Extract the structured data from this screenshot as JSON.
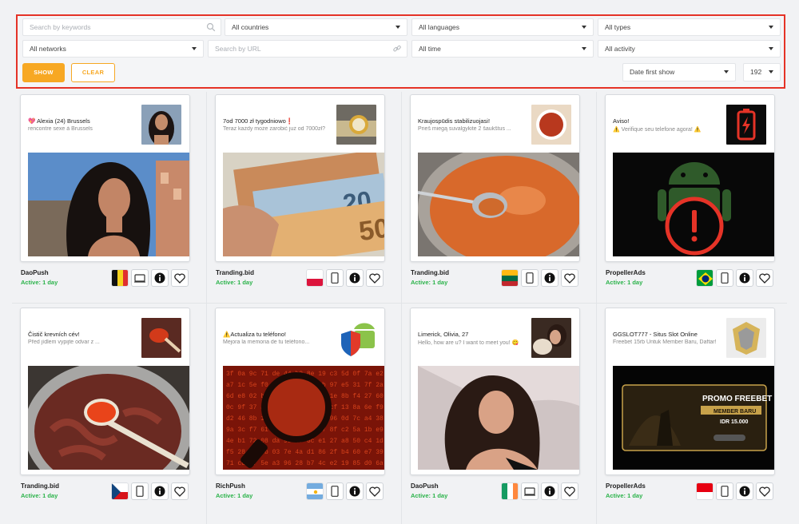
{
  "filters": {
    "keywords_placeholder": "Search by keywords",
    "countries": "All countries",
    "languages": "All languages",
    "types": "All types",
    "networks": "All networks",
    "url_placeholder": "Search by URL",
    "time": "All time",
    "activity": "All activity",
    "show_label": "SHOW",
    "clear_label": "CLEAR",
    "sort": "Date first show",
    "per_page": "192"
  },
  "ads": [
    {
      "title": "💖 Alexia (24) Brussels",
      "subtitle": "rencontre sexe à Brussels",
      "network": "DaoPush",
      "activity": "Active: 1 day",
      "flag": "belgium",
      "device": "desktop",
      "icon": "woman-portrait-icon",
      "image": "woman-selfie-image"
    },
    {
      "title": "7od 7000 zł tygodniowo❗",
      "subtitle": "Teraz każdy może zarobić już od 7000zł?",
      "network": "Tranding.bid",
      "activity": "Active: 1 day",
      "flag": "poland",
      "device": "mobile",
      "icon": "gold-watch-icon",
      "image": "euro-banknotes-image"
    },
    {
      "title": "Kraujospūdis stabilizuojasi!",
      "subtitle": "Prieš miegą suvalgykite 2 šaukštus ...",
      "network": "Tranding.bid",
      "activity": "Active: 1 day",
      "flag": "lithuania",
      "device": "mobile",
      "icon": "sauce-bowl-icon",
      "image": "orange-soup-image"
    },
    {
      "title": "Aviso!",
      "subtitle": "⚠️ Verifique seu telefone agora! ⚠️",
      "network": "PropellerAds",
      "activity": "Active: 1 day",
      "flag": "brazil",
      "device": "mobile",
      "icon": "low-battery-icon",
      "image": "android-warning-image"
    },
    {
      "title": "Čistič krevních cév!",
      "subtitle": "Před jídlem vypijte odvar z ...",
      "network": "Tranding.bid",
      "activity": "Active: 1 day",
      "flag": "czech",
      "device": "mobile",
      "icon": "red-spoon-icon",
      "image": "red-pot-image"
    },
    {
      "title": "⚠️Actualiza tu teléfono!",
      "subtitle": "Mejora la memoria de tu teléfono...",
      "network": "RichPush",
      "activity": "Active: 1 day",
      "flag": "argentina",
      "device": "mobile",
      "icon": "android-shield-icon",
      "image": "magnifier-code-image"
    },
    {
      "title": "Limerick, Olivia, 27",
      "subtitle": "Hello, how are u? I want to meet you! 😋",
      "network": "DaoPush",
      "activity": "Active: 1 day",
      "flag": "ireland",
      "device": "desktop",
      "icon": "woman-dog-icon",
      "image": "woman-bed-image"
    },
    {
      "title": "GGSLOT777 - Situs Slot Online",
      "subtitle": "Freebet 15rb Untuk Member Baru, Daftar!",
      "network": "PropellerAds",
      "activity": "Active: 1 day",
      "flag": "indonesia",
      "device": "mobile",
      "icon": "gold-logo-icon",
      "image": "promo-freebet-image"
    }
  ],
  "promo": {
    "title": "PROMO FREEBET",
    "line1": "MEMBER BARU",
    "line2": "IDR 15.000"
  },
  "colors": {
    "accent": "#f7a823",
    "highlight_border": "#e53327",
    "active_green": "#2bb34a"
  }
}
